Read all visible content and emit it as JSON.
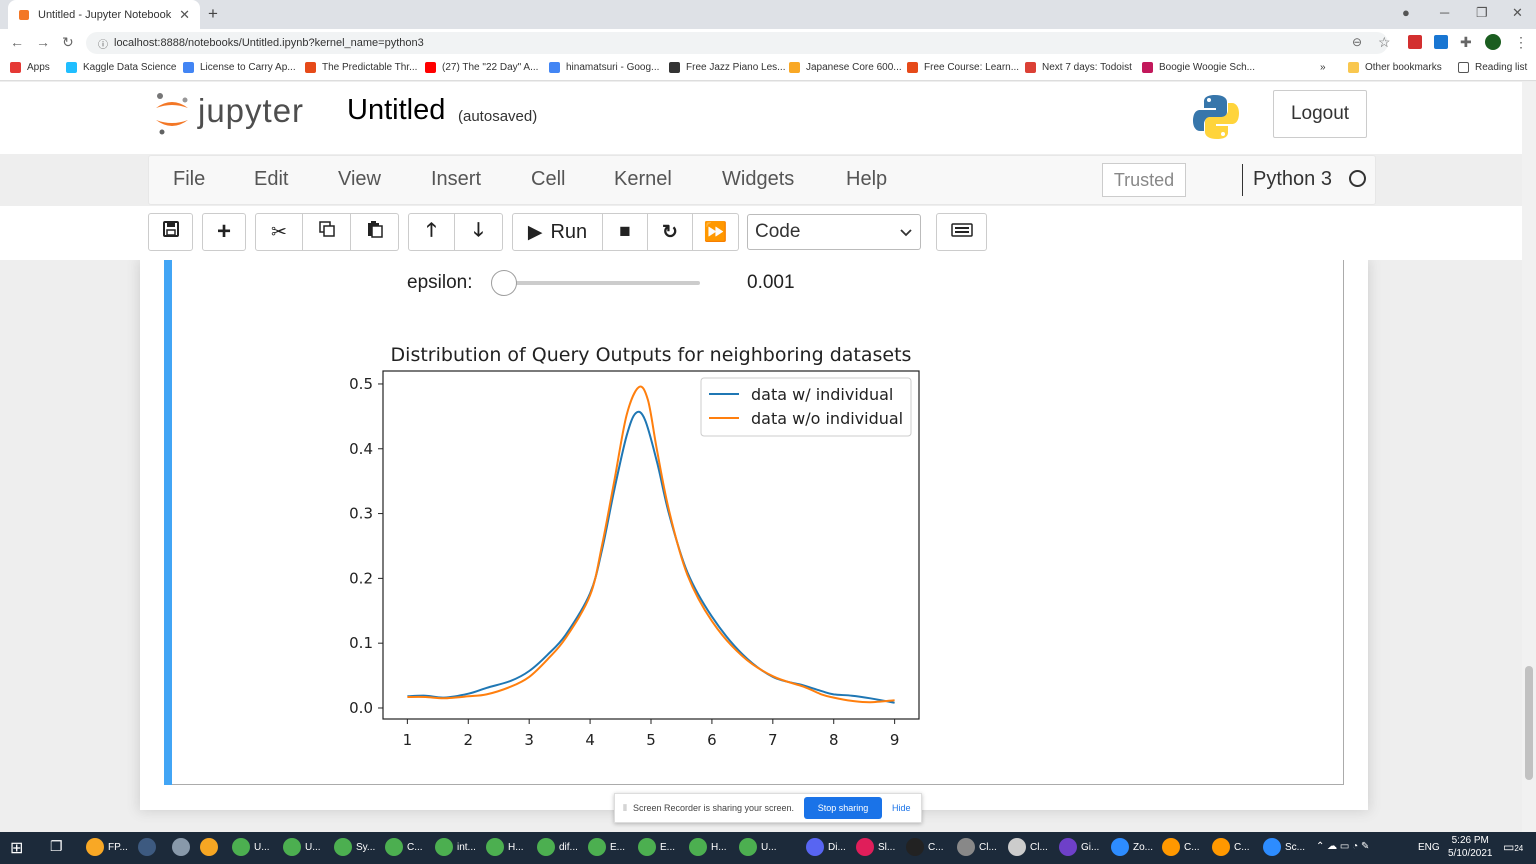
{
  "browser": {
    "tab_title": "Untitled - Jupyter Notebook",
    "url": "localhost:8888/notebooks/Untitled.ipynb?kernel_name=python3",
    "bookmarks": [
      {
        "label": "Apps",
        "color": "#e53935"
      },
      {
        "label": "Kaggle Data Science",
        "color": "#20beff"
      },
      {
        "label": "License to Carry Ap...",
        "color": "#4285f4"
      },
      {
        "label": "The Predictable Thr...",
        "color": "#e64a19"
      },
      {
        "label": "(27) The \"22 Day\" A...",
        "color": "#ff0000"
      },
      {
        "label": "hinamatsuri - Goog...",
        "color": "#4285f4"
      },
      {
        "label": "Free Jazz Piano Les...",
        "color": "#333333"
      },
      {
        "label": "Japanese Core 600...",
        "color": "#f9a825"
      },
      {
        "label": "Free Course: Learn...",
        "color": "#e64a19"
      },
      {
        "label": "Next 7 days: Todoist",
        "color": "#db4035"
      },
      {
        "label": "Boogie Woogie Sch...",
        "color": "#c2185b"
      }
    ],
    "more_bookmarks": "»",
    "other_bookmarks": "Other bookmarks",
    "reading_list": "Reading list"
  },
  "jupyter": {
    "logo_text": "jupyter",
    "notebook_title": "Untitled",
    "autosave_status": "(autosaved)",
    "logout_label": "Logout",
    "menu": [
      "File",
      "Edit",
      "View",
      "Insert",
      "Cell",
      "Kernel",
      "Widgets",
      "Help"
    ],
    "trusted_label": "Trusted",
    "kernel_name": "Python 3",
    "toolbar": {
      "run_label": "Run",
      "cell_type": "Code"
    }
  },
  "widget": {
    "label": "epsilon:",
    "value": "0.001",
    "slider_fraction": 0.0
  },
  "chart_data": {
    "type": "line",
    "title": "Distribution of Query Outputs for neighboring datasets",
    "xlabel": "",
    "ylabel": "",
    "xlim": [
      0.6,
      9.4
    ],
    "ylim": [
      -0.017,
      0.52
    ],
    "xticks": [
      "1",
      "2",
      "3",
      "4",
      "5",
      "6",
      "7",
      "8",
      "9"
    ],
    "yticks": [
      "0.0",
      "0.1",
      "0.2",
      "0.3",
      "0.4",
      "0.5"
    ],
    "legend_position": "top-right",
    "series": [
      {
        "name": "data w/ individual",
        "color": "#1f77b4",
        "x": [
          1.0,
          1.3,
          1.6,
          2.0,
          2.3,
          2.7,
          3.0,
          3.3,
          3.6,
          4.0,
          4.2,
          4.4,
          4.6,
          4.75,
          4.9,
          5.1,
          5.3,
          5.6,
          6.0,
          6.5,
          7.0,
          7.5,
          7.8,
          8.0,
          8.3,
          8.6,
          9.0
        ],
        "y": [
          0.018,
          0.019,
          0.016,
          0.022,
          0.031,
          0.042,
          0.057,
          0.082,
          0.113,
          0.177,
          0.246,
          0.338,
          0.42,
          0.455,
          0.445,
          0.379,
          0.298,
          0.209,
          0.141,
          0.083,
          0.048,
          0.035,
          0.026,
          0.021,
          0.019,
          0.015,
          0.008
        ]
      },
      {
        "name": "data w/o individual",
        "color": "#ff7f0e",
        "x": [
          1.0,
          1.3,
          1.6,
          2.0,
          2.3,
          2.7,
          3.0,
          3.3,
          3.6,
          4.0,
          4.2,
          4.4,
          4.6,
          4.8,
          4.95,
          5.1,
          5.3,
          5.6,
          6.0,
          6.5,
          7.0,
          7.5,
          7.8,
          8.0,
          8.3,
          8.6,
          9.0
        ],
        "y": [
          0.017,
          0.017,
          0.015,
          0.018,
          0.021,
          0.033,
          0.048,
          0.075,
          0.108,
          0.174,
          0.253,
          0.352,
          0.452,
          0.495,
          0.475,
          0.397,
          0.303,
          0.205,
          0.134,
          0.08,
          0.049,
          0.033,
          0.021,
          0.016,
          0.011,
          0.009,
          0.012
        ]
      }
    ]
  },
  "recorder": {
    "message": "Screen Recorder is sharing your screen.",
    "stop_label": "Stop sharing",
    "hide_label": "Hide"
  },
  "taskbar": {
    "items": [
      {
        "label": "FP...",
        "color": "#f9a825"
      },
      {
        "label": "",
        "color": "#3d5a80"
      },
      {
        "label": "",
        "color": "#8899aa"
      },
      {
        "label": "",
        "color": "#f6a623"
      },
      {
        "label": "U...",
        "color": "#4caf50"
      },
      {
        "label": "U...",
        "color": "#4caf50"
      },
      {
        "label": "Sy...",
        "color": "#4caf50"
      },
      {
        "label": "C...",
        "color": "#4caf50"
      },
      {
        "label": "int...",
        "color": "#4caf50"
      },
      {
        "label": "H...",
        "color": "#4caf50"
      },
      {
        "label": "dif...",
        "color": "#4caf50"
      },
      {
        "label": "E...",
        "color": "#4caf50"
      },
      {
        "label": "E...",
        "color": "#4caf50"
      },
      {
        "label": "H...",
        "color": "#4caf50"
      },
      {
        "label": "U...",
        "color": "#4caf50"
      },
      {
        "label": "Di...",
        "color": "#5865f2"
      },
      {
        "label": "Sl...",
        "color": "#e01e5a"
      },
      {
        "label": "C...",
        "color": "#222222"
      },
      {
        "label": "Cl...",
        "color": "#888888"
      },
      {
        "label": "Cl...",
        "color": "#cccccc"
      },
      {
        "label": "Gi...",
        "color": "#6e40c9"
      },
      {
        "label": "Zo...",
        "color": "#2d8cff"
      },
      {
        "label": "C...",
        "color": "#ff9800"
      },
      {
        "label": "C...",
        "color": "#ff9800"
      },
      {
        "label": "Sc...",
        "color": "#2d8cff"
      }
    ],
    "language": "ENG",
    "time": "5:26 PM",
    "date": "5/10/2021",
    "notifications": "24"
  }
}
